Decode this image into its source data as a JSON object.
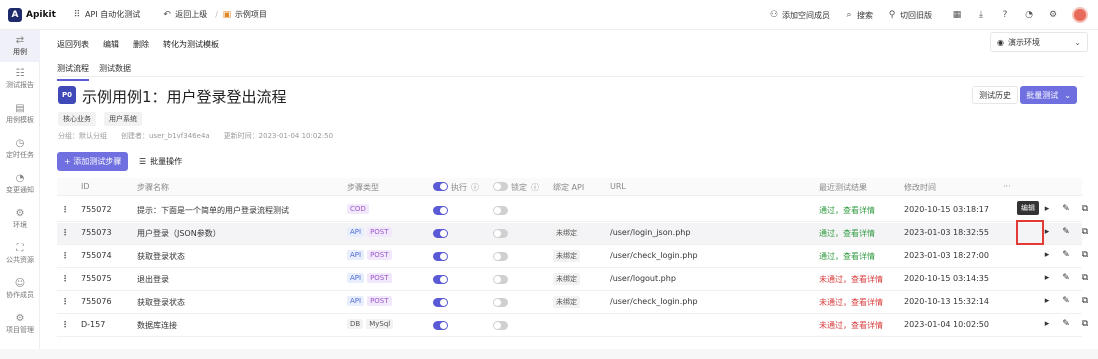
{
  "app": {
    "logo_glyph": "A",
    "name": "Apikit",
    "project": "API 自动化测试",
    "back": "返回上级",
    "example": "示例项目"
  },
  "topright": {
    "add_member": "添加空间成员",
    "search": "搜索",
    "old_version": "切回旧版"
  },
  "sidebar": [
    {
      "label": "用例",
      "icon": "swap-icon",
      "glyph": "⇄"
    },
    {
      "label": "测试报告",
      "icon": "report-icon",
      "glyph": "☷"
    },
    {
      "label": "用例模板",
      "icon": "template-icon",
      "glyph": "▤"
    },
    {
      "label": "定时任务",
      "icon": "timer-icon",
      "glyph": "◷"
    },
    {
      "label": "变更通知",
      "icon": "bell-icon",
      "glyph": "◔"
    },
    {
      "label": "环境",
      "icon": "env-icon",
      "glyph": "⚙"
    },
    {
      "label": "公共资源",
      "icon": "resource-icon",
      "glyph": "⛶"
    },
    {
      "label": "协作成员",
      "icon": "members-icon",
      "glyph": "☺"
    },
    {
      "label": "项目管理",
      "icon": "settings-icon",
      "glyph": "⚙"
    }
  ],
  "actions": {
    "back_list": "返回列表",
    "edit": "编辑",
    "delete": "删除",
    "to_template": "转化为测试模板"
  },
  "env": {
    "label": "演示环境"
  },
  "tabs": {
    "flow": "测试流程",
    "data": "测试数据"
  },
  "case": {
    "priority": "P0",
    "title": "示例用例1：用户登录登出流程",
    "history": "测试历史",
    "batch_test": "批量测试",
    "tags": [
      "核心业务",
      "用户系统"
    ],
    "group": "分组：默认分组",
    "creator": "创建者：user_b1vf346e4a",
    "updated": "更新时间：2023-01-04 10:02:50"
  },
  "steps_toolbar": {
    "add": "+ 添加测试步骤",
    "batch_op": "批量操作"
  },
  "columns": {
    "id": "ID",
    "name": "步骤名称",
    "type": "步骤类型",
    "exec": "执行",
    "lock": "锁定",
    "bind": "绑定 API",
    "url": "URL",
    "result": "最近测试结果",
    "mtime": "修改时间",
    "more": "···"
  },
  "rows": [
    {
      "id": "755072",
      "name": "提示：下面是一个简单的用户登录流程测试",
      "types": [
        "COD"
      ],
      "exec": true,
      "lock": false,
      "bind": "",
      "url": "",
      "result": "通过，查看详情",
      "status": "pass",
      "mtime": "2020-10-15 03:18:17"
    },
    {
      "id": "755073",
      "name": "用户登录（JSON参数）",
      "types": [
        "API",
        "POST"
      ],
      "exec": true,
      "lock": false,
      "bind": "未绑定",
      "url": "/user/login_json.php",
      "result": "通过，查看详情",
      "status": "pass",
      "mtime": "2023-01-03 18:32:55"
    },
    {
      "id": "755074",
      "name": "获取登录状态",
      "types": [
        "API",
        "POST"
      ],
      "exec": true,
      "lock": false,
      "bind": "未绑定",
      "url": "/user/check_login.php",
      "result": "通过，查看详情",
      "status": "pass",
      "mtime": "2023-01-03 18:27:00"
    },
    {
      "id": "755075",
      "name": "退出登录",
      "types": [
        "API",
        "POST"
      ],
      "exec": true,
      "lock": false,
      "bind": "未绑定",
      "url": "/user/logout.php",
      "result": "未通过，查看详情",
      "status": "fail",
      "mtime": "2020-10-15 03:14:35"
    },
    {
      "id": "755076",
      "name": "获取登录状态",
      "types": [
        "API",
        "POST"
      ],
      "exec": true,
      "lock": false,
      "bind": "未绑定",
      "url": "/user/check_login.php",
      "result": "未通过，查看详情",
      "status": "fail",
      "mtime": "2020-10-13 15:32:14"
    },
    {
      "id": "D-157",
      "name": "数据库连接",
      "types": [
        "DB",
        "MySql"
      ],
      "exec": true,
      "lock": false,
      "bind": "",
      "url": "",
      "result": "未通过，查看详情",
      "status": "fail",
      "mtime": "2023-01-04 10:02:50"
    }
  ],
  "tooltip": "编辑",
  "colors": {
    "accent": "#5a5ad6",
    "pass": "#2e9a3e",
    "fail": "#d83a3a",
    "highlight": "#e53935"
  }
}
